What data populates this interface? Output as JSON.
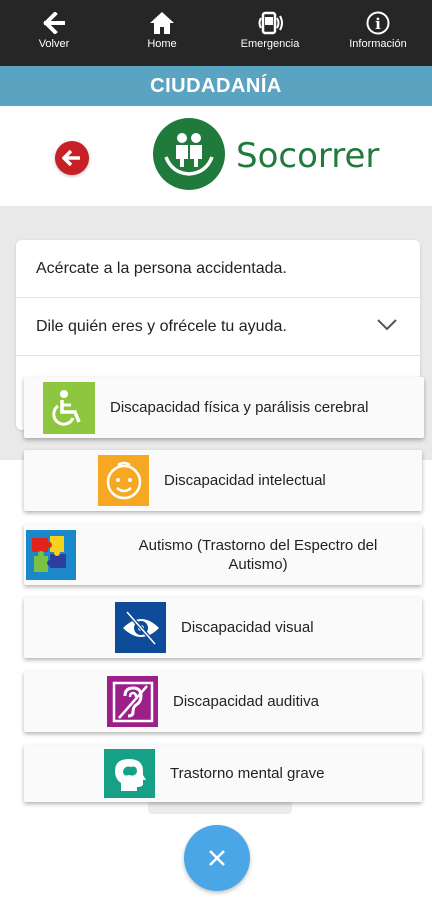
{
  "nav": {
    "back": "Volver",
    "home": "Home",
    "emergency": "Emergencia",
    "info": "Información"
  },
  "section": {
    "title": "CIUDADANÍA"
  },
  "logo": {
    "text": "Socorrer"
  },
  "steps": [
    "Acércate a la persona accidentada.",
    "Dile quién eres y ofrécele tu ayuda."
  ],
  "categories": [
    {
      "label": "Discapacidad física y parálisis cerebral",
      "icon": "wheelchair-icon",
      "color": "#8ec63f"
    },
    {
      "label": "Discapacidad intelectual",
      "icon": "face-icon",
      "color": "#f7a823"
    },
    {
      "label": "Autismo (Trastorno del Espectro del Autismo)",
      "icon": "puzzle-icon",
      "color": "#1a88c9"
    },
    {
      "label": "Discapacidad visual",
      "icon": "eye-icon",
      "color": "#0e4c9a"
    },
    {
      "label": "Discapacidad auditiva",
      "icon": "ear-icon",
      "color": "#9c1f8a"
    },
    {
      "label": "Trastorno mental grave",
      "icon": "head-icon",
      "color": "#16a085"
    }
  ],
  "colors": {
    "topbar": "#262626",
    "section": "#5aa4c2",
    "brand": "#1f7a3c",
    "back_button": "#c71f26",
    "fab": "#4aa6e6"
  }
}
